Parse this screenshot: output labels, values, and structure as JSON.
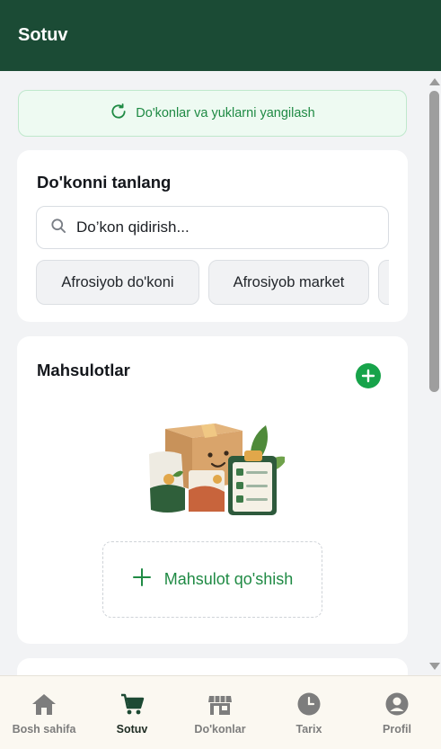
{
  "header": {
    "title": "Sotuv"
  },
  "refresh": {
    "label": "Do'konlar va yuklarni yangilash"
  },
  "shop_select": {
    "title": "Do'konni tanlang",
    "search_placeholder": "Do’kon qidirish...",
    "chips": [
      "Afrosiyob do'koni",
      "Afrosiyob market",
      ""
    ]
  },
  "products": {
    "title": "Mahsulotlar",
    "add_label": "Mahsulot qo'shish"
  },
  "nav": {
    "items": [
      {
        "label": "Bosh sahifa",
        "icon": "home-icon"
      },
      {
        "label": "Sotuv",
        "icon": "cart-icon",
        "active": true
      },
      {
        "label": "Do'konlar",
        "icon": "store-icon"
      },
      {
        "label": "Tarix",
        "icon": "clock-icon"
      },
      {
        "label": "Profil",
        "icon": "user-icon"
      }
    ]
  },
  "colors": {
    "header_bg": "#1b4b35",
    "accent_green": "#17a34a",
    "refresh_text": "#1f8a44"
  }
}
